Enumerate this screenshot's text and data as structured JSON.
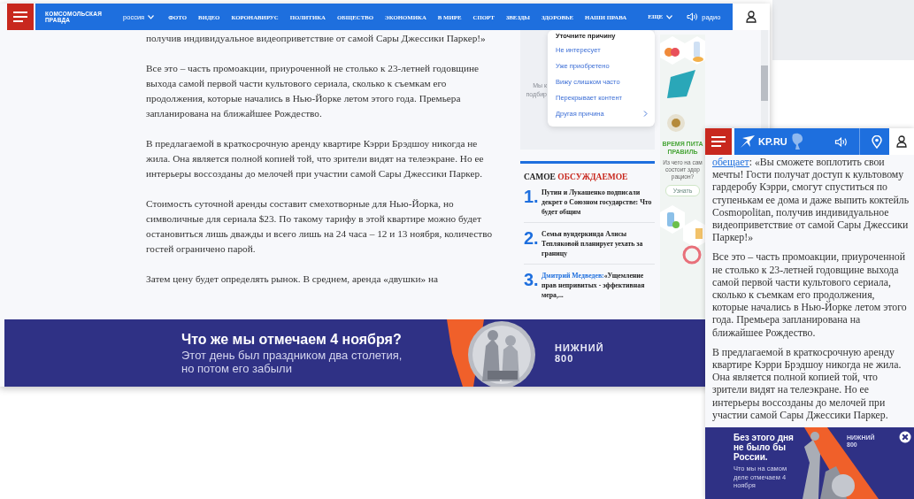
{
  "desktop_page": {
    "header": {
      "logo_text": [
        "КОМСОМОЛЬСКАЯ",
        "ПРАВДА"
      ],
      "region": "россия",
      "nav": [
        "ФОТО",
        "ВИДЕО",
        "КОРОНАВИРУС",
        "ПОЛИТИКА",
        "ОБЩЕСТВО",
        "ЭКОНОМИКА",
        "В МИРЕ",
        "СПОРТ",
        "ЗВЕЗДЫ",
        "ЗДОРОВЬЕ",
        "НАШИ ПРАВА"
      ],
      "more": "ЕЩЕ",
      "radio": "радио"
    },
    "article": {
      "paragraphs": [
        "получив индивидуальное видеоприветствие от самой Сары Джессики Паркер!»",
        "Все это – часть промоакции, приуроченной не столько к 23-летней годовщине выхода самой первой части культового сериала, сколько к съемкам его продолжения, которые начались в Нью-Йорке летом этого года. Премьера запланирована на ближайшее Рождество.",
        "В предлагаемой в краткосрочную аренду квартире Кэрри Брэдшоу никогда не жила. Она является полной копией той, что зрители видят на телеэкране. Но ее интерьеры воссозданы до мелочей при участии самой Сары Джессики Паркер.",
        "Стоимость суточной аренды составит смехотворные для Нью-Йорка, но символичные для сериала $23. По такому тарифу в этой квартире можно будет остановиться лишь дважды и всего лишь на 24 часа – 12 и 13 ноября, количество гостей ограничено парой.",
        "Затем цену будет определять рынок. В среднем, аренда «двушки» на"
      ]
    },
    "ad_panel": {
      "texts": [
        "Мы к",
        "подбир"
      ]
    },
    "reason_menu": {
      "title": "Уточните причину",
      "options": [
        {
          "label": "Не интересует",
          "submenu": false
        },
        {
          "label": "Уже приобретено",
          "submenu": false
        },
        {
          "label": "Вижу слишком часто",
          "submenu": false
        },
        {
          "label": "Перекрывает контент",
          "submenu": false
        },
        {
          "label": "Другая причина",
          "submenu": true
        }
      ]
    },
    "side_ad": {
      "headline": [
        "ВРЕМЯ ПИТА",
        "ПРАВИЛЬ"
      ],
      "text": [
        "Из чего на сам",
        "состоит здор",
        "рацион?"
      ],
      "button": "Узнать"
    },
    "most_discussed": {
      "title": "САМОЕ",
      "title_accent": "ОБСУЖДАЕМОЕ",
      "items": [
        {
          "number": "1.",
          "title": "Путин и Лукашенко подписали декрет о Союзном государстве: Что будет общим"
        },
        {
          "number": "2.",
          "title": "Семья вундеркинда Алисы Тепляковой планирует уехать за границу"
        },
        {
          "number": "3.",
          "kicker": "Дмитрий Медведев:",
          "title": "«Ущемление прав непривитых - эффективная мера,..."
        }
      ]
    },
    "banner": {
      "title": "Что же мы отмечаем 4 ноября?",
      "subtitle": "Этот день был праздником два столетия, но потом его забыли",
      "brand": [
        "НИЖНИЙ",
        "800"
      ]
    }
  },
  "mobile_page": {
    "header": {
      "logo_text": "KP.RU"
    },
    "article": {
      "paragraphs": [
        {
          "link": "обещает",
          "text": ": «Вы сможете воплотить свои мечты! Гости получат доступ к культовому гардеробу Кэрри, смогут спуститься по ступенькам ее дома и даже выпить коктейль Cosmopolitan, получив индивидуальное видеоприветствие от самой Сары Джессики Паркер!»"
        },
        {
          "text": "Все это – часть промоакции, приуроченной не столько к 23-летней годовщине выхода самой первой части культового сериала, сколько к съемкам его продолжения, которые начались в Нью-Йорке летом этого года. Премьера запланирована на ближайшее Рождество."
        },
        {
          "text": "В предлагаемой в краткосрочную аренду квартире Кэрри Брэдшоу никогда не жила. Она является полной копией той, что зрители видят на телеэкране. Но ее интерьеры воссозданы до мелочей при участии самой Сары Джессики Паркер."
        }
      ]
    },
    "banner": {
      "title": "Без этого дня не было бы России.",
      "subtitle": "Что мы на самом деле отмечаем 4 ноября",
      "brand": [
        "НИЖНИЙ",
        "800"
      ]
    }
  }
}
